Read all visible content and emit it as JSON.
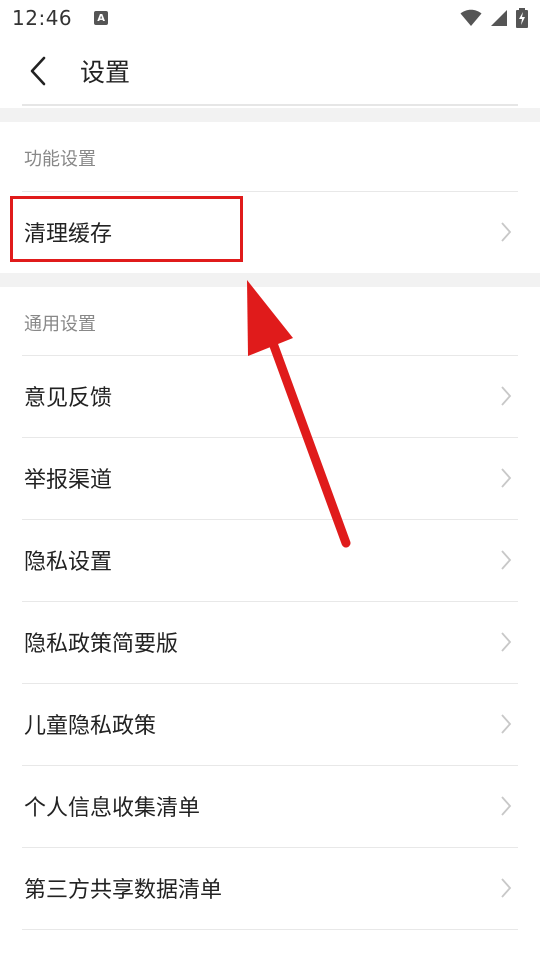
{
  "status_bar": {
    "time": "12:46",
    "app_icon_letter": "A"
  },
  "header": {
    "title": "设置"
  },
  "sections": {
    "function": {
      "label": "功能设置",
      "items": [
        {
          "label": "清理缓存"
        }
      ]
    },
    "general": {
      "label": "通用设置",
      "items": [
        {
          "label": "意见反馈"
        },
        {
          "label": "举报渠道"
        },
        {
          "label": "隐私设置"
        },
        {
          "label": "隐私政策简要版"
        },
        {
          "label": "儿童隐私政策"
        },
        {
          "label": "个人信息收集清单"
        },
        {
          "label": "第三方共享数据清单"
        }
      ]
    }
  },
  "colors": {
    "annotation": "#e01b1b",
    "section_bg": "#f2f2f2",
    "chevron": "#c8c8c8"
  }
}
